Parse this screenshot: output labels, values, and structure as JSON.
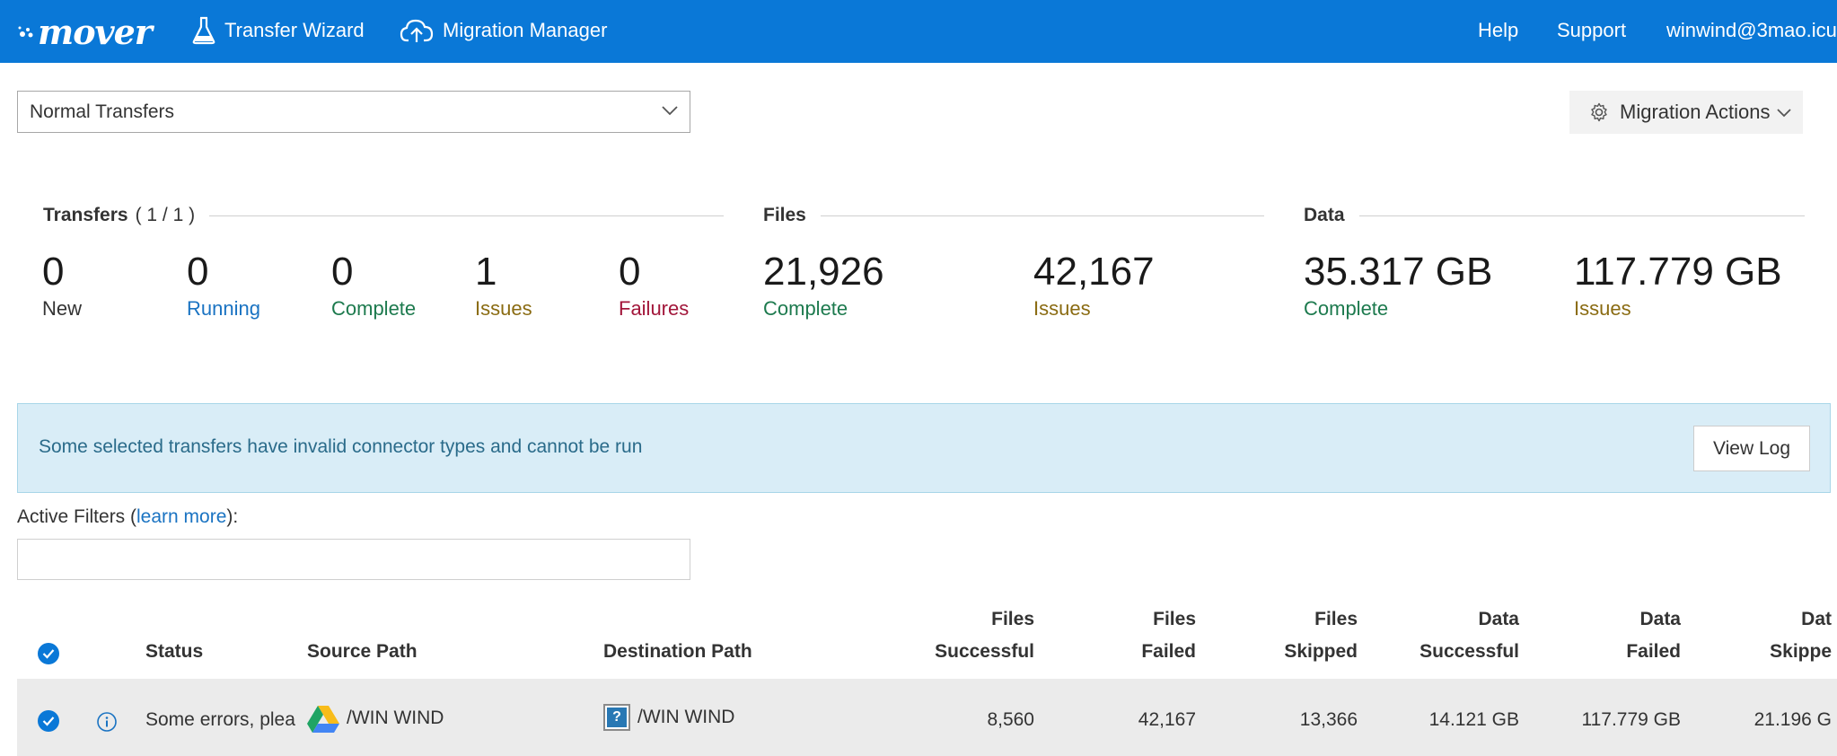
{
  "nav": {
    "logo_text": "mover",
    "transfer_wizard": "Transfer Wizard",
    "migration_manager": "Migration Manager",
    "help": "Help",
    "support": "Support",
    "user": "winwind@3mao.icu"
  },
  "controls": {
    "transfer_filter": "Normal Transfers",
    "migration_actions": "Migration Actions"
  },
  "stats": {
    "transfers": {
      "title": "Transfers",
      "count": "( 1 / 1 )",
      "items": [
        {
          "value": "0",
          "label": "New"
        },
        {
          "value": "0",
          "label": "Running"
        },
        {
          "value": "0",
          "label": "Complete"
        },
        {
          "value": "1",
          "label": "Issues"
        },
        {
          "value": "0",
          "label": "Failures"
        }
      ]
    },
    "files": {
      "title": "Files",
      "items": [
        {
          "value": "21,926",
          "label": "Complete"
        },
        {
          "value": "42,167",
          "label": "Issues"
        }
      ]
    },
    "data": {
      "title": "Data",
      "items": [
        {
          "value": "35.317 GB",
          "label": "Complete"
        },
        {
          "value": "117.779 GB",
          "label": "Issues"
        }
      ]
    }
  },
  "alert": {
    "message": "Some selected transfers have invalid connector types and cannot be run",
    "view_log": "View Log"
  },
  "filters": {
    "label_prefix": "Active Filters (",
    "learn_more": "learn more",
    "label_suffix": "):",
    "value": ""
  },
  "table": {
    "headers": {
      "status": "Status",
      "source_path": "Source Path",
      "destination_path": "Destination Path",
      "files_successful": [
        "Files",
        "Successful"
      ],
      "files_failed": [
        "Files",
        "Failed"
      ],
      "files_skipped": [
        "Files",
        "Skipped"
      ],
      "data_successful": [
        "Data",
        "Successful"
      ],
      "data_failed": [
        "Data",
        "Failed"
      ],
      "data_skipped": [
        "Dat",
        "Skippe"
      ]
    },
    "rows": [
      {
        "status": "Some errors, plea",
        "source_path": "/WIN WIND",
        "destination_path": "/WIN WIND",
        "files_successful": "8,560",
        "files_failed": "42,167",
        "files_skipped": "13,366",
        "data_successful": "14.121 GB",
        "data_failed": "117.779 GB",
        "data_skipped": "21.196 G"
      }
    ]
  },
  "colors": {
    "brand_blue": "#0a78d7",
    "complete_green": "#1d7a4e",
    "issues_amber": "#8a6b12",
    "failures_red": "#a2163a",
    "running_blue": "#1a73c2",
    "alert_bg": "#d9edf7"
  },
  "icons": {
    "wizard": "flask-icon",
    "migration": "cloud-upload-icon",
    "actions": "gear-icon",
    "source_connector": "google-drive-icon",
    "destination_connector": "unknown-connector-icon",
    "row_info": "info-icon"
  }
}
